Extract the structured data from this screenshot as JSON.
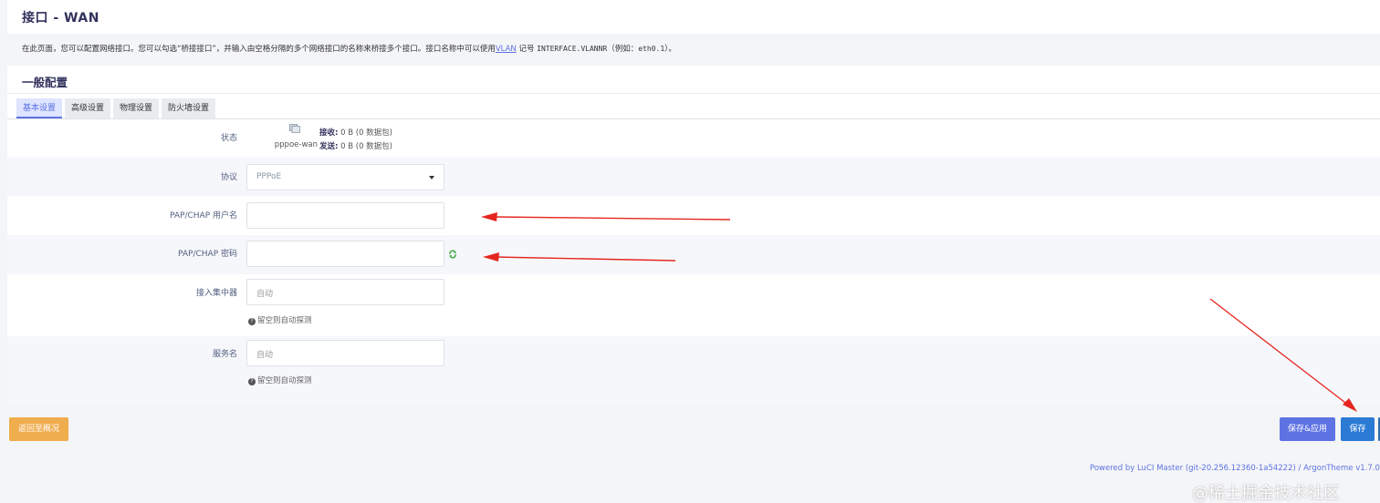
{
  "header": {
    "title": "接口 - WAN"
  },
  "description": {
    "before": "在此页面，您可以配置网络接口。您可以勾选“桥接接口”，并输入由空格分隔的多个网络接口的名称来桥接多个接口。接口名称中可以使用",
    "link": "VLAN",
    "mid": " 记号 ",
    "code": "INTERFACE.VLANNR",
    "after_open": "（例如：",
    "example": "eth0.1",
    "after_close": "）。"
  },
  "section": {
    "title": "一般配置"
  },
  "tabs": [
    "基本设置",
    "高级设置",
    "物理设置",
    "防火墙设置"
  ],
  "status": {
    "label": "状态",
    "iface": "pppoe-wan",
    "rx_label": "接收:",
    "rx_value": " 0 B (0 数据包)",
    "tx_label": "发送:",
    "tx_value": " 0 B (0 数据包)"
  },
  "fields": {
    "protocol": {
      "label": "协议",
      "value": "PPPoE"
    },
    "username": {
      "label": "PAP/CHAP 用户名",
      "value": ""
    },
    "password": {
      "label": "PAP/CHAP 密码",
      "value": ""
    },
    "ac": {
      "label": "接入集中器",
      "placeholder": "自动",
      "hint": "留空则自动探测"
    },
    "service": {
      "label": "服务名",
      "placeholder": "自动",
      "hint": "留空则自动探测"
    }
  },
  "buttons": {
    "back": "返回至概况",
    "save_apply": "保存&应用",
    "save": "保存"
  },
  "footer": {
    "powered": "Powered by LuCI Master (git-20.256.12360-1a54222) / ArgonTheme v1.7.0 / OpenWrt"
  },
  "watermark": "@稀土掘金技术社区",
  "colors": {
    "accent": "#5e72e4",
    "warning": "#f0ad4e",
    "save": "#2b7bd5",
    "annotation": "#e5261f"
  }
}
